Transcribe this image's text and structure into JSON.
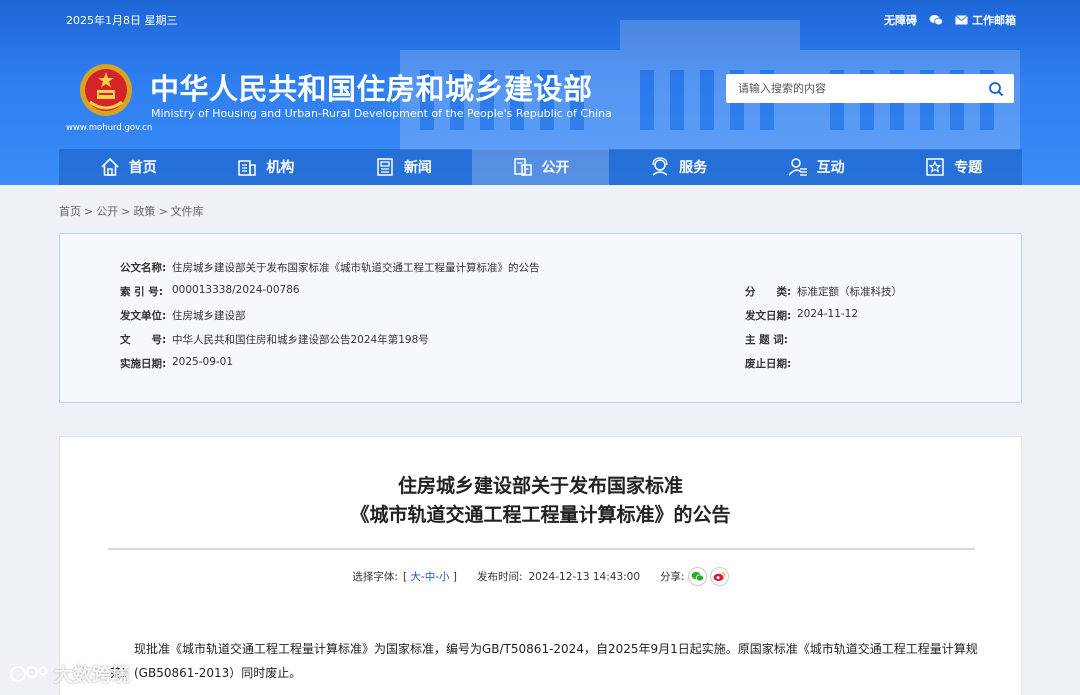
{
  "topbar": {
    "date": "2025年1月8日 星期三",
    "accessibility": "无障碍",
    "mailbox": "工作邮箱"
  },
  "site": {
    "title": "中华人民共和国住房和城乡建设部",
    "subtitle": "Ministry of Housing and Urban-Rural Development of the People's Republic of China",
    "url": "www.mohurd.gov.cn"
  },
  "search": {
    "placeholder": "请输入搜索的内容"
  },
  "nav": [
    {
      "label": "首页",
      "icon": "home-icon"
    },
    {
      "label": "机构",
      "icon": "building-icon"
    },
    {
      "label": "新闻",
      "icon": "news-icon"
    },
    {
      "label": "公开",
      "icon": "open-icon"
    },
    {
      "label": "服务",
      "icon": "service-icon"
    },
    {
      "label": "互动",
      "icon": "interact-icon"
    },
    {
      "label": "专题",
      "icon": "topic-icon"
    }
  ],
  "nav_active": "公开",
  "breadcrumb": [
    "首页",
    "公开",
    "政策",
    "文件库"
  ],
  "meta": {
    "doc_name_label": "公文名称:",
    "doc_name": "住房城乡建设部关于发布国家标准《城市轨道交通工程工程量计算标准》的公告",
    "index_label": "索 引 号:",
    "index": "000013338/2024-00786",
    "category_label": "分　　类:",
    "category": "标准定额（标准科技）",
    "issuer_label": "发文单位:",
    "issuer": "住房城乡建设部",
    "issue_date_label": "发文日期:",
    "issue_date": "2024-11-12",
    "doc_no_label": "文　　号:",
    "doc_no": "中华人民共和国住房和城乡建设部公告2024年第198号",
    "subject_label": "主 题 词:",
    "subject": "",
    "effective_label": "实施日期:",
    "effective": "2025-09-01",
    "repeal_label": "废止日期:",
    "repeal": ""
  },
  "article": {
    "title_line1": "住房城乡建设部关于发布国家标准",
    "title_line2": "《城市轨道交通工程工程量计算标准》的公告",
    "font_label": "选择字体:",
    "font_open": "[",
    "font_large": "大",
    "font_medium": "中",
    "font_small": "小",
    "font_close": "]",
    "font_dash": "-",
    "publish_label": "发布时间:",
    "publish_time": "2024-12-13 14:43:00",
    "share_label": "分享:",
    "body": "现批准《城市轨道交通工程工程量计算标准》为国家标准，编号为GB/T50861-2024，自2025年9月1日起实施。原国家标准《城市轨道交通工程工程量计算规范》(GB50861-2013）同时废止。"
  },
  "watermark": "大数跨境",
  "colors": {
    "header_blue": "#2f7ff0",
    "link_blue": "#1a56c8",
    "meta_border": "#b9d3ee",
    "wechat_green": "#2aae2a",
    "weibo_red": "#e6162d"
  }
}
